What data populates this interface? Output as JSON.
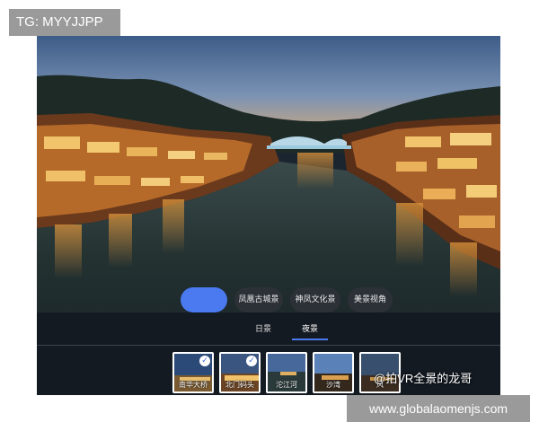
{
  "top_tag": "TG: MYYJJPP",
  "bottom_tag": "www.globalaomenjs.com",
  "watermark": "@拍VR全景的龙哥",
  "chips": [
    {
      "label": "",
      "active": true
    },
    {
      "label": "凤凰古城景",
      "active": false
    },
    {
      "label": "神凤文化景",
      "active": false
    },
    {
      "label": "美景视角",
      "active": false
    }
  ],
  "tabs": [
    {
      "label": "日景",
      "active": false
    },
    {
      "label": "夜景",
      "active": true
    }
  ],
  "thumbnails": [
    {
      "label": "南华大桥",
      "checked": true
    },
    {
      "label": "北门码头",
      "checked": true
    },
    {
      "label": "沱江河",
      "checked": false
    },
    {
      "label": "沙湾",
      "checked": false
    },
    {
      "label": "风",
      "checked": false
    }
  ],
  "colors": {
    "accent": "#4a79f0",
    "panel": "#141a22",
    "tag": "#9a9a9a"
  }
}
